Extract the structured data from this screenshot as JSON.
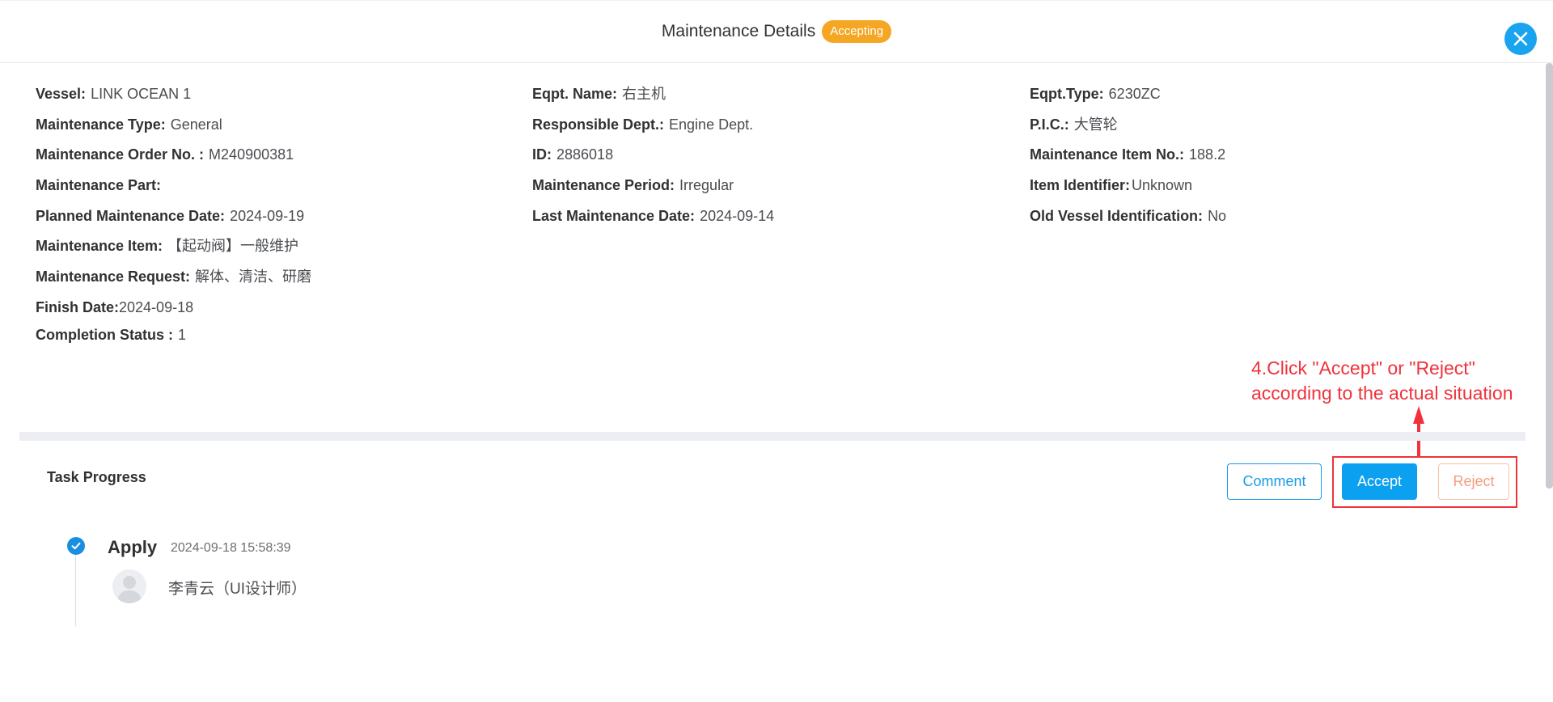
{
  "header": {
    "title": "Maintenance Details",
    "status_badge": "Accepting"
  },
  "details": {
    "col1": [
      {
        "label": "Vessel:",
        "value": "LINK OCEAN 1"
      },
      {
        "label": "Maintenance Type:",
        "value": "General"
      },
      {
        "label": "Maintenance Order No. :",
        "value": "M240900381"
      },
      {
        "label": "Maintenance Part:",
        "value": ""
      },
      {
        "label": "Planned Maintenance Date:",
        "value": "2024-09-19"
      },
      {
        "label": "Maintenance Item:",
        "value": "【起动阀】一般维护"
      },
      {
        "label": "Maintenance Request:",
        "value": "解体、清洁、研磨"
      },
      {
        "label": "Finish Date:",
        "value": "2024-09-18"
      },
      {
        "label": "Completion Status :",
        "value": "1"
      }
    ],
    "col2": [
      {
        "label": "Eqpt. Name:",
        "value": "右主机"
      },
      {
        "label": "Responsible Dept.:",
        "value": "Engine Dept."
      },
      {
        "label": "ID:",
        "value": "2886018"
      },
      {
        "label": "Maintenance Period:",
        "value": "Irregular"
      },
      {
        "label": "Last Maintenance Date:",
        "value": "2024-09-14"
      }
    ],
    "col3": [
      {
        "label": "Eqpt.Type:",
        "value": "6230ZC"
      },
      {
        "label": "P.I.C.:",
        "value": "大管轮"
      },
      {
        "label": "Maintenance Item No.:",
        "value": "188.2"
      },
      {
        "label": "Item Identifier:",
        "value": "Unknown"
      },
      {
        "label": "Old Vessel Identification:",
        "value": "No"
      }
    ]
  },
  "annotation": {
    "line1": "4.Click \"Accept\" or \"Reject\"",
    "line2": "according to the actual situation"
  },
  "task_progress": {
    "title": "Task Progress",
    "buttons": {
      "comment": "Comment",
      "accept": "Accept",
      "reject": "Reject"
    },
    "steps": [
      {
        "title": "Apply",
        "time": "2024-09-18 15:58:39",
        "person": "李青云（UI设计师）"
      }
    ]
  },
  "colors": {
    "accent": "#0ba0f0",
    "badge": "#f5a623",
    "annotation": "#f0323c"
  }
}
